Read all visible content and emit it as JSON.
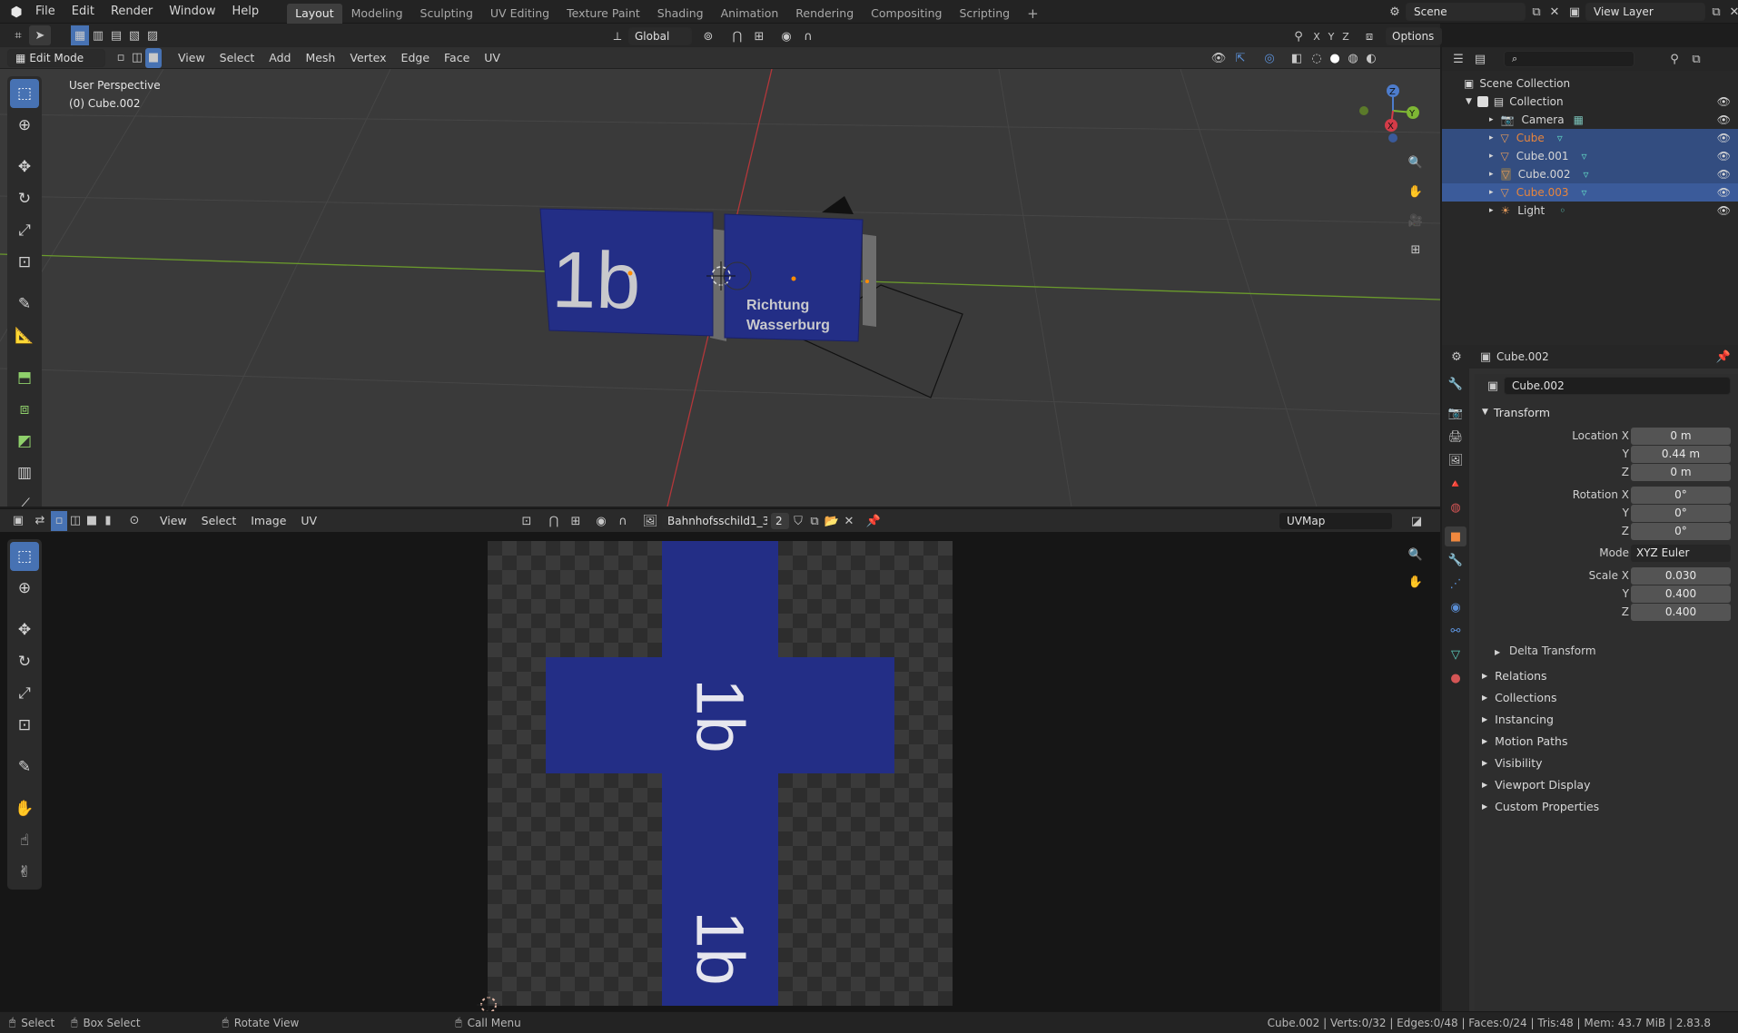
{
  "topbar": {
    "menus": [
      "File",
      "Edit",
      "Render",
      "Window",
      "Help"
    ],
    "workspaces": [
      "Layout",
      "Modeling",
      "Sculpting",
      "UV Editing",
      "Texture Paint",
      "Shading",
      "Animation",
      "Rendering",
      "Compositing",
      "Scripting"
    ],
    "active_workspace": "Layout",
    "scene": "Scene",
    "view_layer": "View Layer"
  },
  "viewport": {
    "mode": "Edit Mode",
    "menus": [
      "View",
      "Select",
      "Add",
      "Mesh",
      "Vertex",
      "Edge",
      "Face",
      "UV"
    ],
    "transform_orientation": "Global",
    "options_label": "Options",
    "axes": [
      "X",
      "Y",
      "Z"
    ],
    "perspective_label": "User Perspective",
    "object_label": "(0) Cube.002",
    "sign_left_text": "1b",
    "sign_right_line1": "Richtung",
    "sign_right_line2": "Wasserburg",
    "gizmo_axes": [
      "Z",
      "Y",
      "X"
    ]
  },
  "uv_editor": {
    "menus": [
      "View",
      "Select",
      "Image",
      "UV"
    ],
    "image_name": "Bahnhofsschild1_3_...",
    "users": "2",
    "uv_map": "UVMap",
    "texture_text_top": "1b",
    "texture_text_bottom": "1b"
  },
  "outliner": {
    "root": "Scene Collection",
    "collection": "Collection",
    "items": [
      {
        "name": "Camera",
        "type": "camera",
        "selected": false
      },
      {
        "name": "Cube",
        "type": "mesh",
        "selected": true
      },
      {
        "name": "Cube.001",
        "type": "mesh",
        "selected": true
      },
      {
        "name": "Cube.002",
        "type": "mesh",
        "selected": true
      },
      {
        "name": "Cube.003",
        "type": "mesh",
        "selected": true,
        "active": true
      },
      {
        "name": "Light",
        "type": "light",
        "selected": false
      }
    ]
  },
  "properties": {
    "object_name": "Cube.002",
    "datablock_name": "Cube.002",
    "transform_label": "Transform",
    "location": {
      "label_x": "Location X",
      "x": "0 m",
      "y": "0.44 m",
      "z": "0 m"
    },
    "rotation": {
      "label_x": "Rotation X",
      "x": "0°",
      "y": "0°",
      "z": "0°"
    },
    "mode_label": "Mode",
    "mode_value": "XYZ Euler",
    "scale": {
      "label_x": "Scale X",
      "x": "0.030",
      "y": "0.400",
      "z": "0.400"
    },
    "axis_y": "Y",
    "axis_z": "Z",
    "delta_transform": "Delta Transform",
    "panels": [
      "Relations",
      "Collections",
      "Instancing",
      "Motion Paths",
      "Visibility",
      "Viewport Display",
      "Custom Properties"
    ]
  },
  "statusbar": {
    "select": "Select",
    "box_select": "Box Select",
    "rotate_view": "Rotate View",
    "call_menu": "Call Menu",
    "stats": "Cube.002 | Verts:0/32 | Edges:0/48 | Faces:0/24 | Tris:48 | Mem: 43.7 MiB | 2.83.8"
  },
  "colors": {
    "accent": "#4772b3",
    "sign_blue": "#232e86",
    "x_axis": "#b3373a",
    "y_axis": "#6a9a2c",
    "selected_row": "#334d80",
    "active_name": "#e8853c"
  }
}
